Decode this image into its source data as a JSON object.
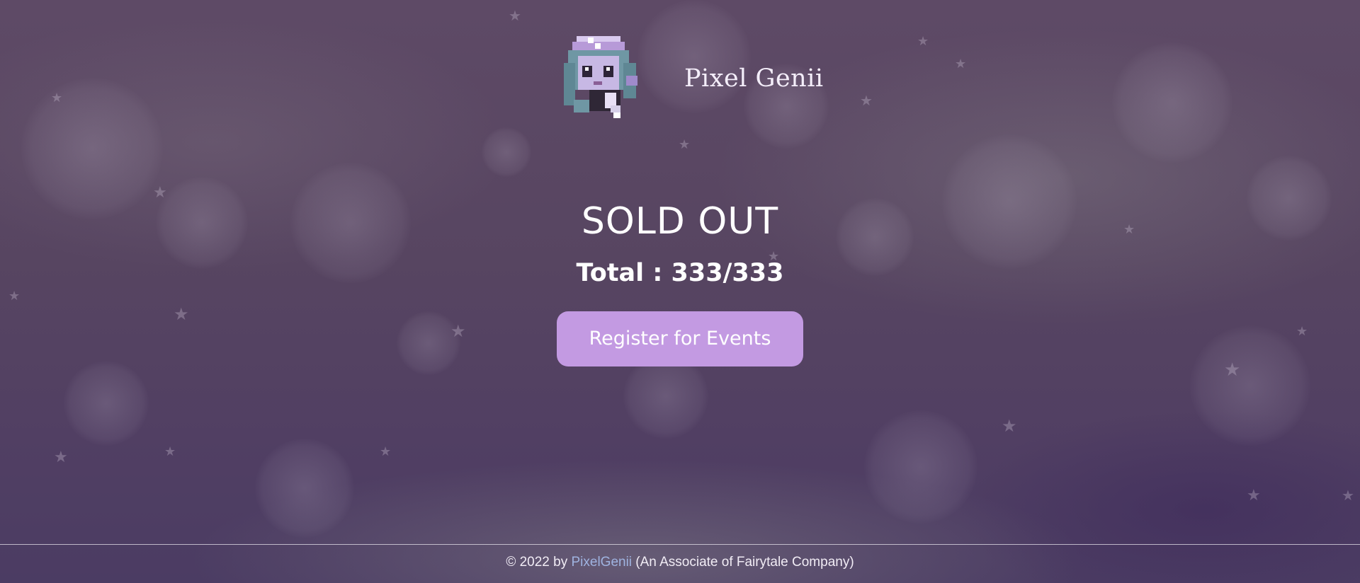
{
  "header": {
    "brand_name": "Pixel Genii",
    "logo_icon": "pixel-genie-mascot"
  },
  "main": {
    "status_title": "SOLD OUT",
    "total_label": "Total : 333/333",
    "register_button_label": "Register for Events"
  },
  "footer": {
    "copyright_prefix": "© 2022 by ",
    "company_link": "PixelGenii",
    "suffix": " (An Associate of Fairytale Company)"
  },
  "colors": {
    "background": "#574561",
    "button": "#c39ae2",
    "link": "#9fb3e0",
    "text": "#ffffff"
  }
}
